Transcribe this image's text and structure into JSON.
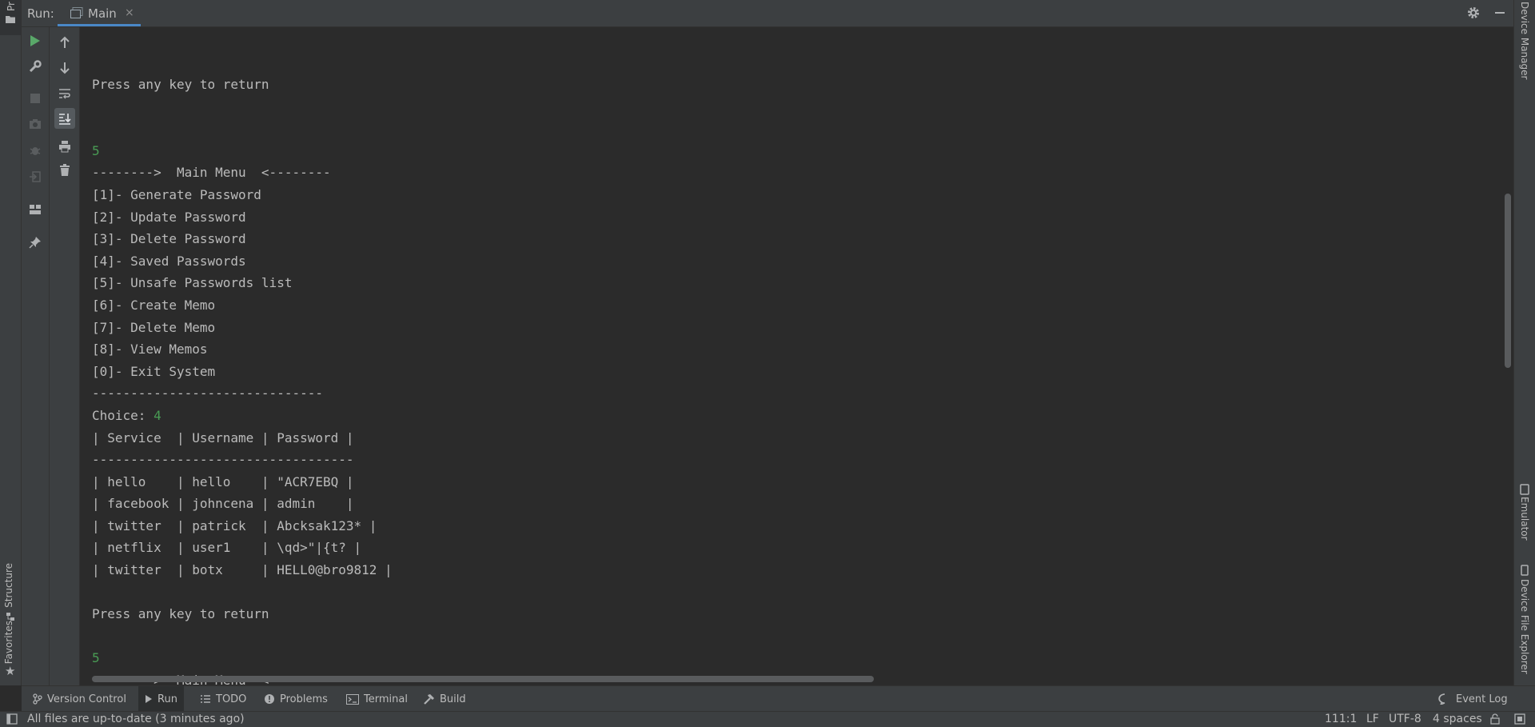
{
  "left_strip": {
    "project_label": "Pr",
    "structure_label": "Structure",
    "favorites_label": "Favorites"
  },
  "header": {
    "run_label": "Run:",
    "tab_label": "Main",
    "close_glyph": "×"
  },
  "console": {
    "lines": [
      {
        "text": "Press any key to return",
        "kind": "out"
      },
      {
        "text": "",
        "kind": "out"
      },
      {
        "text": "",
        "kind": "out"
      },
      {
        "text": "5",
        "kind": "input"
      },
      {
        "text": "-------->  Main Menu  <--------",
        "kind": "out"
      },
      {
        "text": "[1]- Generate Password",
        "kind": "out"
      },
      {
        "text": "[2]- Update Password",
        "kind": "out"
      },
      {
        "text": "[3]- Delete Password",
        "kind": "out"
      },
      {
        "text": "[4]- Saved Passwords",
        "kind": "out"
      },
      {
        "text": "[5]- Unsafe Passwords list",
        "kind": "out"
      },
      {
        "text": "[6]- Create Memo",
        "kind": "out"
      },
      {
        "text": "[7]- Delete Memo",
        "kind": "out"
      },
      {
        "text": "[8]- View Memos",
        "kind": "out"
      },
      {
        "text": "[0]- Exit System",
        "kind": "out"
      },
      {
        "text": "------------------------------",
        "kind": "out"
      },
      {
        "text": "Choice: ",
        "kind": "out",
        "input": "4"
      },
      {
        "text": "| Service  | Username | Password |",
        "kind": "out"
      },
      {
        "text": "----------------------------------",
        "kind": "out"
      },
      {
        "text": "| hello    | hello    | \"ACR7EBQ |",
        "kind": "out"
      },
      {
        "text": "| facebook | johncena | admin    |",
        "kind": "out"
      },
      {
        "text": "| twitter  | patrick  | Abcksak123* |",
        "kind": "out"
      },
      {
        "text": "| netflix  | user1    | \\qd>\"|{t? |",
        "kind": "out"
      },
      {
        "text": "| twitter  | botx     | HELL0@bro9812 |",
        "kind": "out"
      },
      {
        "text": "",
        "kind": "out"
      },
      {
        "text": "Press any key to return",
        "kind": "out"
      },
      {
        "text": "",
        "kind": "out"
      },
      {
        "text": "5",
        "kind": "input"
      },
      {
        "text": "-------->  Main Menu  <--------",
        "kind": "out"
      }
    ]
  },
  "right_strip": {
    "device_manager": "Device Manager",
    "emulator": "Emulator",
    "device_file_explorer": "Device File Explorer"
  },
  "tool_tabs": {
    "version_control": "Version Control",
    "run": "Run",
    "todo": "TODO",
    "problems": "Problems",
    "terminal": "Terminal",
    "build": "Build",
    "event_log": "Event Log"
  },
  "status_bar": {
    "message": "All files are up-to-date (3 minutes ago)",
    "position": "111:1",
    "line_ending": "LF",
    "encoding": "UTF-8",
    "indent": "4 spaces"
  },
  "colors": {
    "background": "#2b2b2b",
    "panel": "#3c3f41",
    "text": "#bbbbbb",
    "user_input": "#499c54",
    "run_green": "#59a869",
    "tab_underline": "#4a88c7"
  }
}
